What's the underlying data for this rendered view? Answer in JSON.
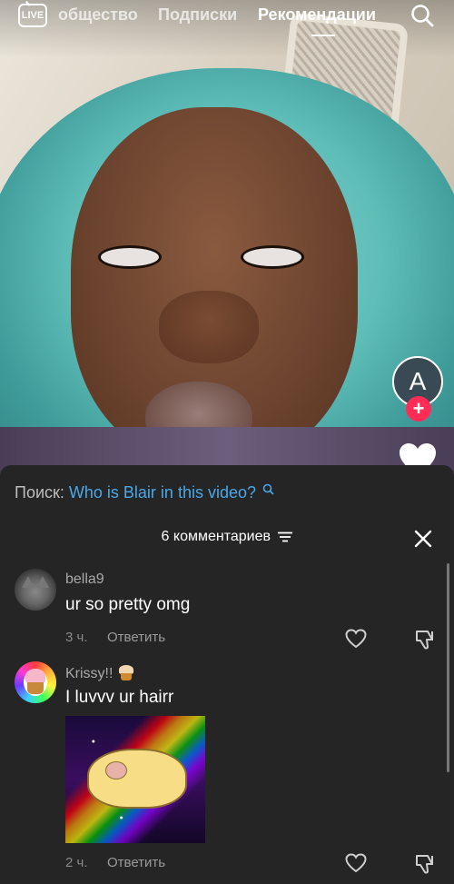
{
  "top_nav": {
    "live_label": "LIVE",
    "tabs": [
      "общество",
      "Подписки",
      "Рекомендации"
    ],
    "active_tab": "Рекомендации"
  },
  "right_rail": {
    "avatar_letter": "A"
  },
  "comments_panel": {
    "search_prefix": "Поиск:",
    "search_query": "Who is Blair in this video?",
    "count_label": "6 комментариев",
    "comments": [
      {
        "username": "bella9",
        "text": "ur so pretty omg",
        "time": "3 ч.",
        "reply_label": "Ответить",
        "avatar_icon": "cat-avatar"
      },
      {
        "username": "Krissy!!",
        "text": "I luvvv ur hairr",
        "time": "2 ч.",
        "reply_label": "Ответить",
        "avatar_icon": "cupcake-avatar",
        "attachment_icon": "pug-rainbow-sticker"
      }
    ]
  },
  "colors": {
    "sheet_bg": "#252525",
    "link_blue": "#4aa8e8",
    "follow_red": "#ff2d55"
  }
}
